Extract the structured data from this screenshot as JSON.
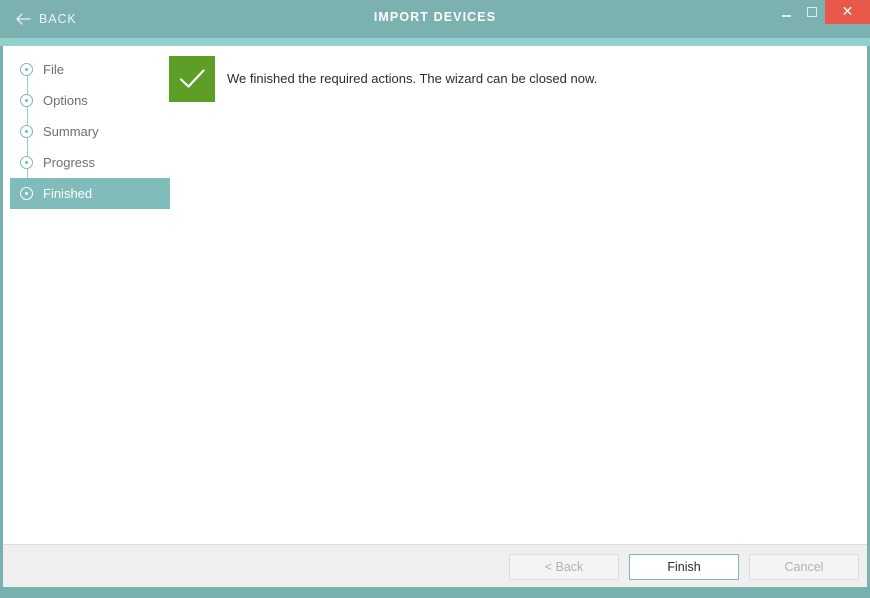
{
  "titlebar": {
    "back_label": "BACK",
    "back_icon": "arrow-left-icon",
    "title": "IMPORT DEVICES",
    "minimize_icon": "minimize-icon",
    "maximize_icon": "maximize-icon",
    "close_icon": "close-icon",
    "close_glyph": "✕",
    "close_color": "#e8584b",
    "accent_color": "#93cfcd",
    "bar_color": "#7bb2b0"
  },
  "sidebar": {
    "steps": [
      {
        "label": "File",
        "icon": "step-circle-icon",
        "active": false
      },
      {
        "label": "Options",
        "icon": "step-circle-icon",
        "active": false
      },
      {
        "label": "Summary",
        "icon": "step-circle-icon",
        "active": false
      },
      {
        "label": "Progress",
        "icon": "step-circle-icon",
        "active": false
      },
      {
        "label": "Finished",
        "icon": "step-circle-icon",
        "active": true
      }
    ],
    "active_color": "#7fbcba"
  },
  "main": {
    "status_icon": "check-icon",
    "status_color": "#5d9e26",
    "message": "We finished the required actions. The wizard can be closed now."
  },
  "footer": {
    "back_label": "< Back",
    "finish_label": "Finish",
    "cancel_label": "Cancel",
    "primary_border_color": "#7fb8b6"
  }
}
